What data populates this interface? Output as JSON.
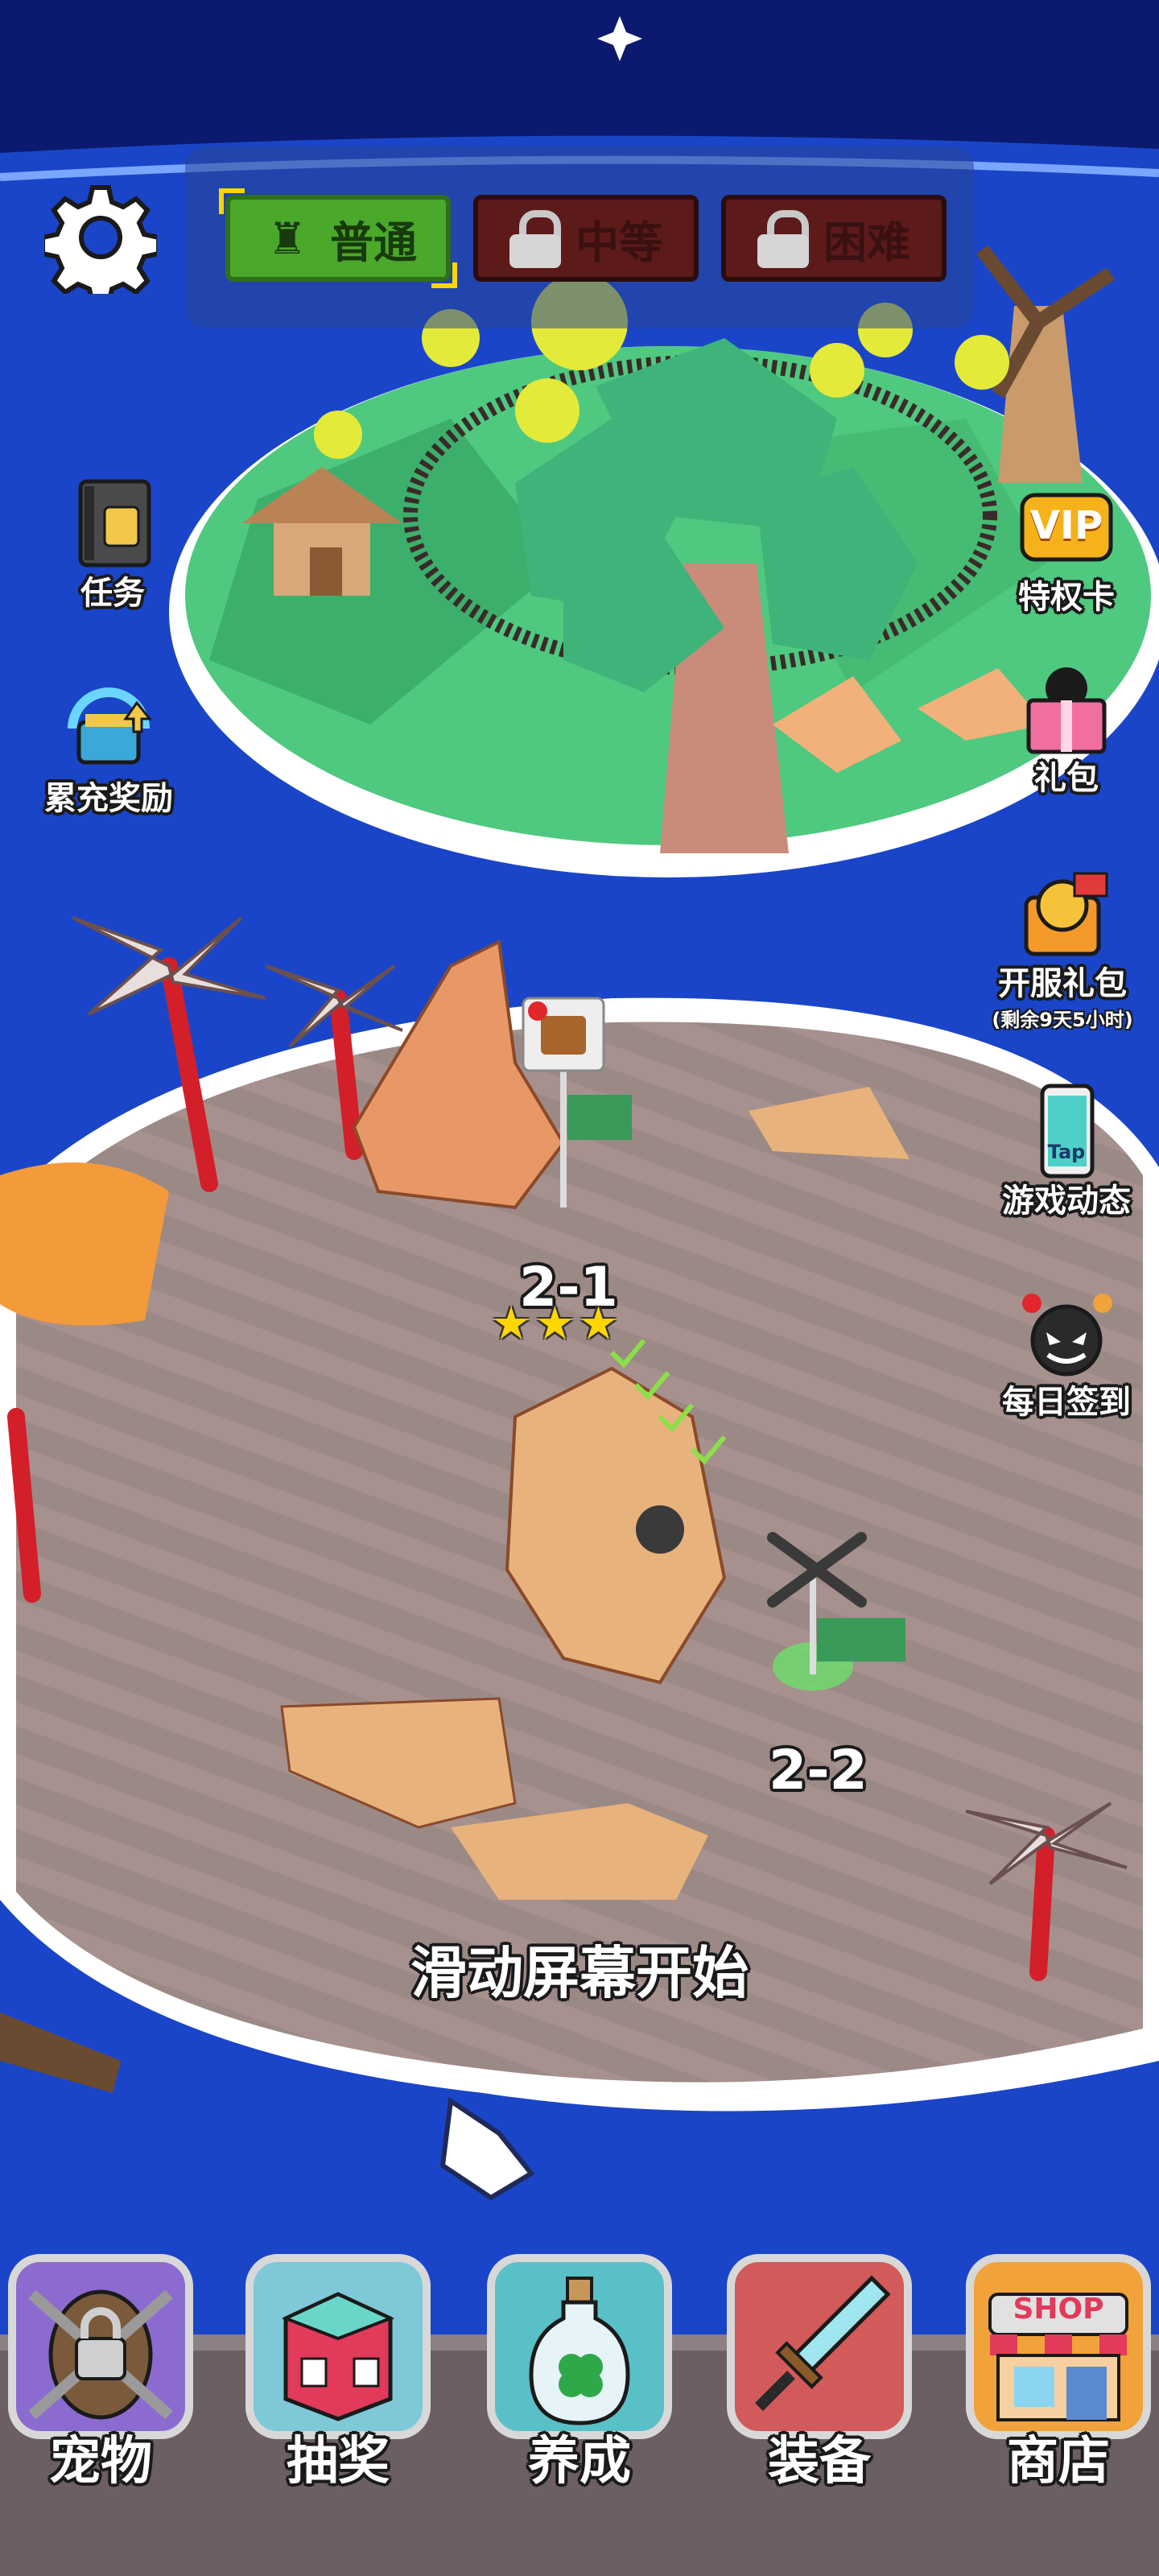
{
  "difficulty": {
    "normal": "普通",
    "medium": "中等",
    "hard": "困难"
  },
  "side_left": {
    "tasks": "任务",
    "recharge_reward": "累充奖励"
  },
  "side_right": {
    "vip_badge": "VIP",
    "vip": "特权卡",
    "gift_pack": "礼包",
    "server_gift": "开服礼包",
    "server_gift_timer": "(剩余9天5小时)",
    "news": "游戏动态",
    "news_badge": "Tap",
    "daily_checkin": "每日签到"
  },
  "levels": {
    "level_1": "2-1",
    "level_1_stars": "★★★",
    "level_2": "2-2"
  },
  "hint": "滑动屏幕开始",
  "nav": {
    "pet": "宠物",
    "lottery": "抽奖",
    "nurture": "养成",
    "equipment": "装备",
    "shop": "商店",
    "shop_sign": "SHOP"
  },
  "colors": {
    "sky": "#0b1a6e",
    "ocean": "#1a45c8",
    "island_grass": "#4fc97f",
    "island_sand": "#9c8a88",
    "accent_green": "#4aa82b",
    "locked_red": "#5c1a1a"
  },
  "icons": {
    "settings": "gear-icon",
    "lock": "lock-icon",
    "tower": "castle-icon"
  }
}
